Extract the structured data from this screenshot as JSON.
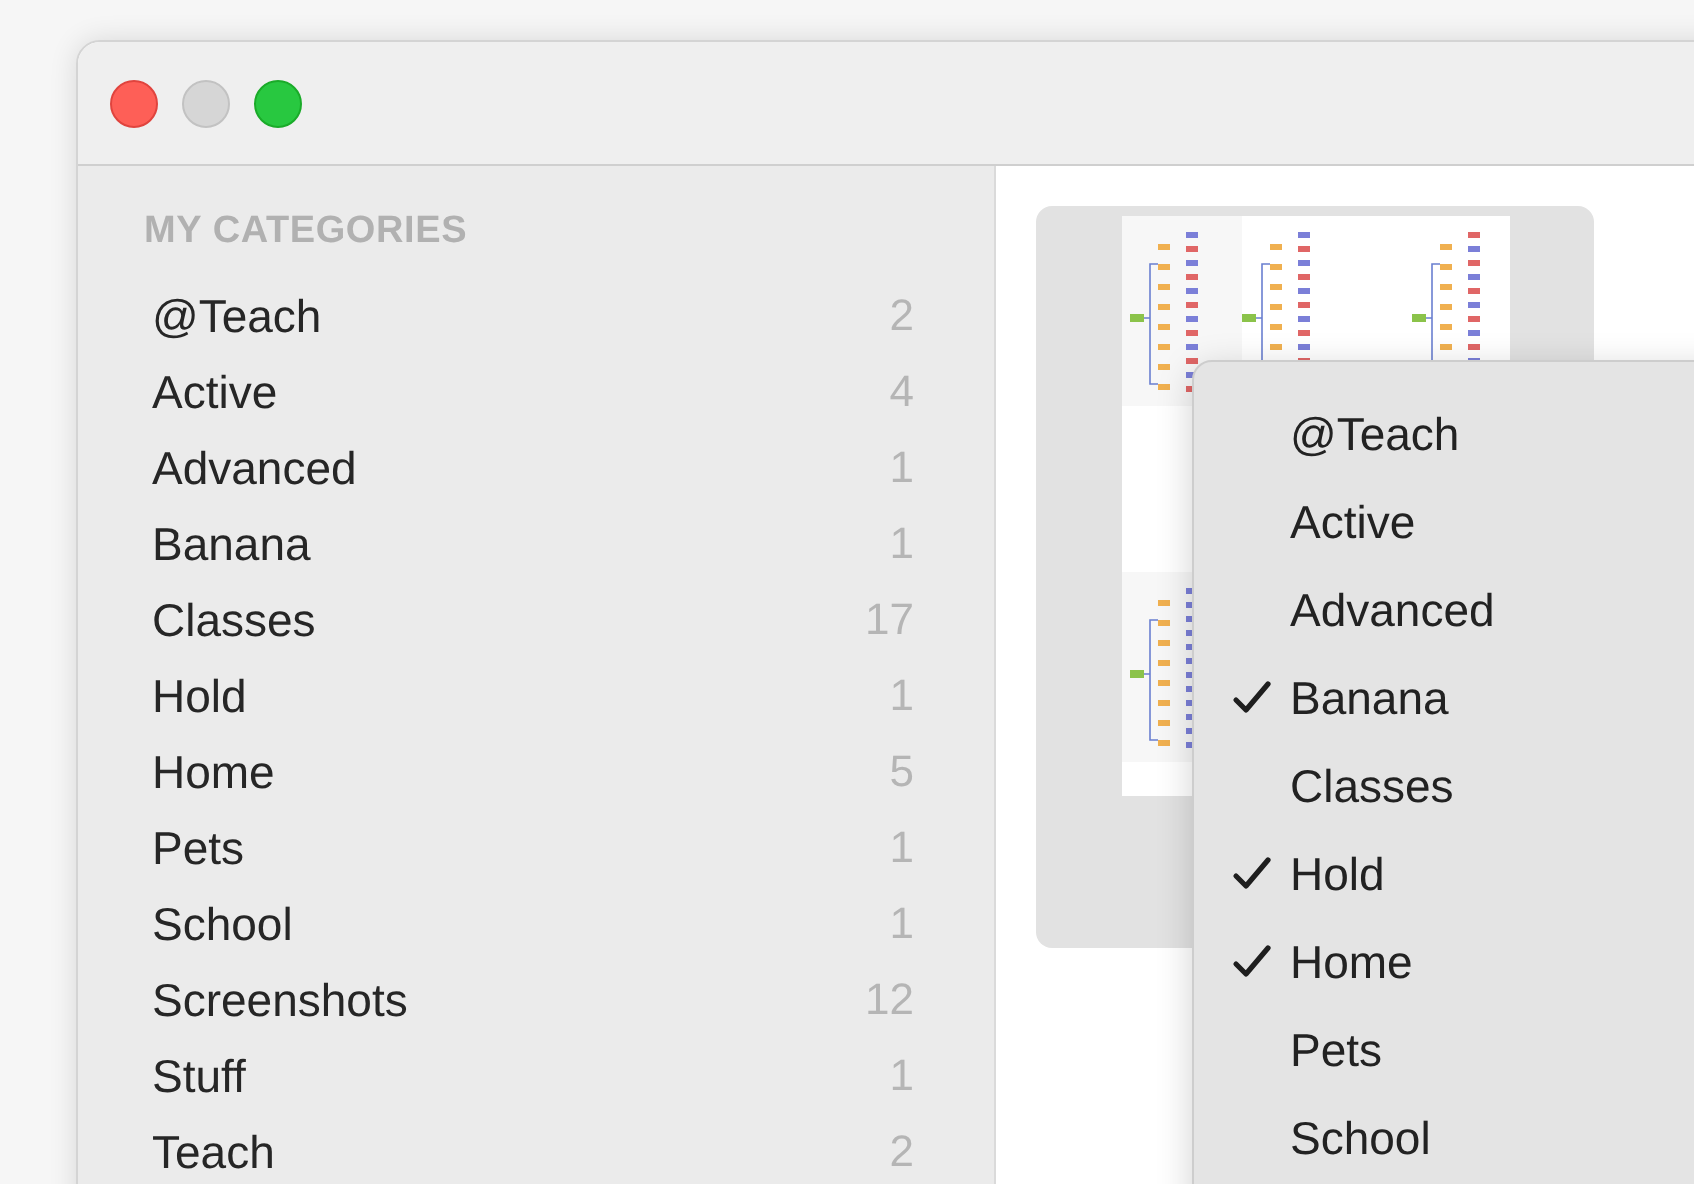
{
  "sidebar": {
    "header": "MY CATEGORIES",
    "items": [
      {
        "name": "@Teach",
        "count": "2"
      },
      {
        "name": "Active",
        "count": "4"
      },
      {
        "name": "Advanced",
        "count": "1"
      },
      {
        "name": "Banana",
        "count": "1"
      },
      {
        "name": "Classes",
        "count": "17"
      },
      {
        "name": "Hold",
        "count": "1"
      },
      {
        "name": "Home",
        "count": "5"
      },
      {
        "name": "Pets",
        "count": "1"
      },
      {
        "name": "School",
        "count": "1"
      },
      {
        "name": "Screenshots",
        "count": "12"
      },
      {
        "name": "Stuff",
        "count": "1"
      },
      {
        "name": "Teach",
        "count": "2"
      }
    ]
  },
  "menu": {
    "items": [
      {
        "label": "@Teach",
        "checked": false
      },
      {
        "label": "Active",
        "checked": false
      },
      {
        "label": "Advanced",
        "checked": false
      },
      {
        "label": "Banana",
        "checked": true
      },
      {
        "label": "Classes",
        "checked": false
      },
      {
        "label": "Hold",
        "checked": true
      },
      {
        "label": "Home",
        "checked": true
      },
      {
        "label": "Pets",
        "checked": false
      },
      {
        "label": "School",
        "checked": false
      }
    ]
  }
}
